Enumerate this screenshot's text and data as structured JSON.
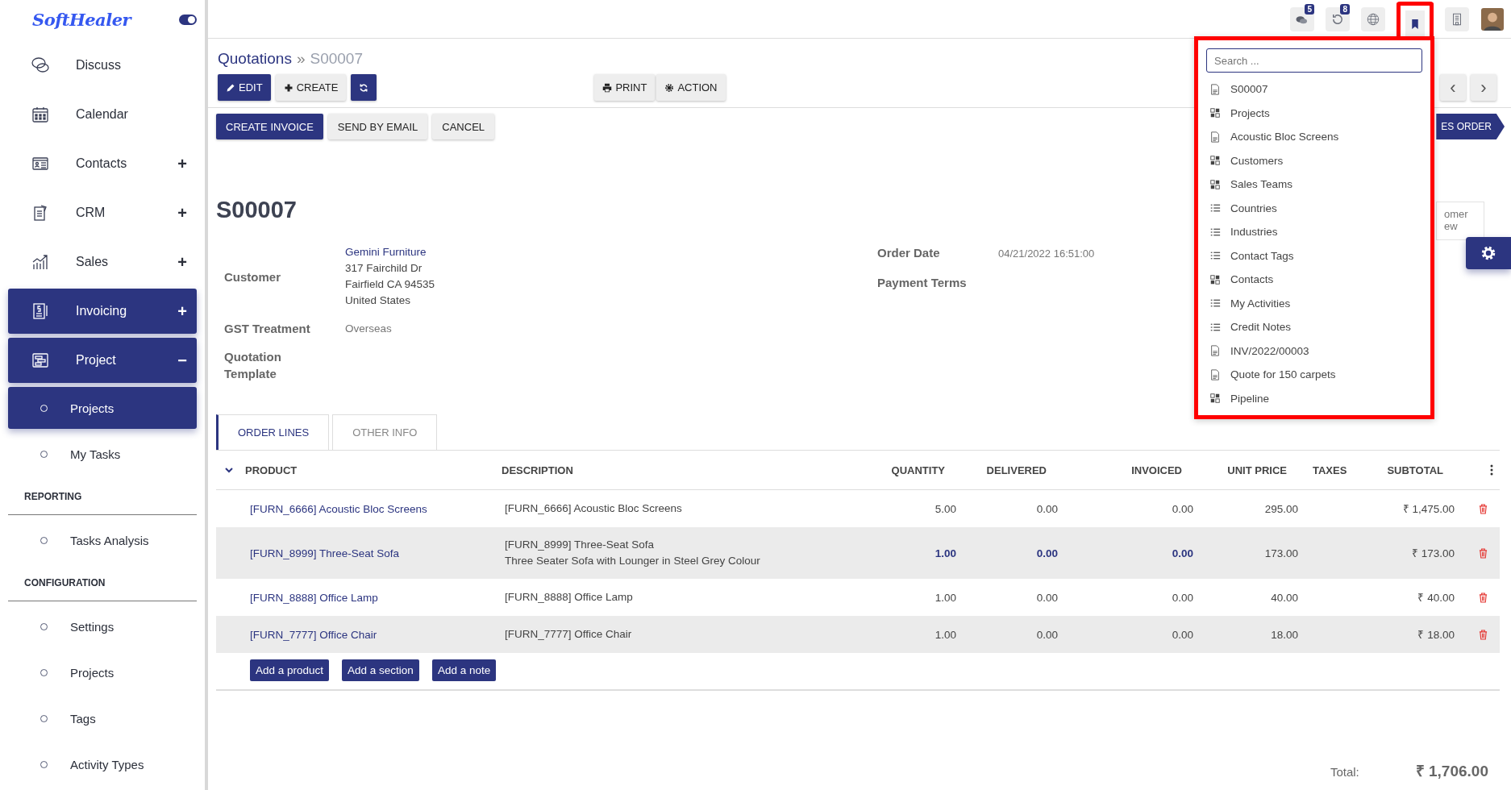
{
  "sidebar": {
    "logo": "SoftHealer",
    "theme_toggle": {
      "on": true
    },
    "items": [
      {
        "kind": "app",
        "label": "Discuss",
        "selected": false
      },
      {
        "kind": "app",
        "label": "Calendar",
        "selected": false
      },
      {
        "kind": "app",
        "label": "Contacts",
        "toggle": "+",
        "selected": false
      },
      {
        "kind": "app",
        "label": "CRM",
        "toggle": "+",
        "selected": false
      },
      {
        "kind": "app",
        "label": "Sales",
        "toggle": "+",
        "selected": false
      },
      {
        "kind": "app",
        "label": "Invoicing",
        "toggle": "+",
        "selected": true
      },
      {
        "kind": "app",
        "label": "Project",
        "toggle": "−",
        "selected": true,
        "children": [
          {
            "kind": "link",
            "label": "Projects",
            "selected": true
          },
          {
            "kind": "link",
            "label": "My Tasks",
            "selected": false
          },
          {
            "kind": "section",
            "label": "REPORTING"
          },
          {
            "kind": "link",
            "label": "Tasks Analysis",
            "selected": false
          },
          {
            "kind": "section",
            "label": "CONFIGURATION"
          },
          {
            "kind": "link",
            "label": "Settings",
            "selected": false
          },
          {
            "kind": "link",
            "label": "Projects",
            "selected": false
          },
          {
            "kind": "link",
            "label": "Tags",
            "selected": false
          },
          {
            "kind": "link",
            "label": "Activity Types",
            "selected": false
          }
        ]
      }
    ]
  },
  "topbar": {
    "icons": [
      {
        "kind": "chat",
        "badge": "5",
        "highlighted": false
      },
      {
        "kind": "clock",
        "badge": "8",
        "highlighted": false
      },
      {
        "kind": "globe",
        "highlighted": false
      },
      {
        "kind": "bookmark",
        "highlighted": true
      },
      {
        "kind": "building",
        "highlighted": false
      },
      {
        "kind": "avatar",
        "highlighted": false
      }
    ]
  },
  "breadcrumb": {
    "parent": "Quotations",
    "separator": "»",
    "current": "S00007"
  },
  "toolbar": {
    "buttons": [
      {
        "kind": "primary",
        "label": "EDIT"
      },
      {
        "kind": "secondary",
        "label": "CREATE"
      },
      {
        "kind": "primary"
      }
    ],
    "actions": [
      {
        "label": "PRINT"
      },
      {
        "label": "ACTION"
      }
    ],
    "pager": [
      "‹",
      "›"
    ]
  },
  "status_buttons": [
    {
      "kind": "primary",
      "label": "CREATE INVOICE"
    },
    {
      "kind": "secondary",
      "label": "SEND BY EMAIL"
    },
    {
      "kind": "secondary",
      "label": "CANCEL"
    }
  ],
  "status_stage": "ES ORDER",
  "smart_button": [
    "omer",
    "ew"
  ],
  "form": {
    "title": "S00007",
    "left": [
      {
        "label": "Customer",
        "link": "Gemini Furniture",
        "lines": [
          "317 Fairchild Dr",
          "Fairfield CA 94535",
          "United States"
        ]
      },
      {
        "label": "GST Treatment",
        "value": "Overseas"
      },
      {
        "label": "Quotation Template"
      }
    ],
    "right": [
      {
        "label": "Order Date",
        "value": "04/21/2022 16:51:00"
      },
      {
        "label": "Payment Terms"
      }
    ]
  },
  "tabs": [
    {
      "label": "ORDER LINES",
      "selected": true
    },
    {
      "label": "OTHER INFO",
      "selected": false
    }
  ],
  "table": {
    "columns": [
      "PRODUCT",
      "DESCRIPTION",
      "QUANTITY",
      "DELIVERED",
      "INVOICED",
      "UNIT PRICE",
      "TAXES",
      "SUBTOTAL"
    ],
    "rows": [
      {
        "product": "[FURN_6666] Acoustic Bloc Screens",
        "description": [
          "[FURN_6666] Acoustic Bloc Screens"
        ],
        "quantity": "5.00",
        "delivered": "0.00",
        "invoiced": "0.00",
        "unit_price": "295.00",
        "subtotal": "₹ 1,475.00",
        "highlighted": false
      },
      {
        "product": "[FURN_8999] Three-Seat Sofa",
        "description": [
          "[FURN_8999] Three-Seat Sofa",
          "Three Seater Sofa with Lounger in Steel Grey Colour"
        ],
        "quantity": "1.00",
        "delivered": "0.00",
        "invoiced": "0.00",
        "unit_price": "173.00",
        "subtotal": "₹ 173.00",
        "highlighted": true
      },
      {
        "product": "[FURN_8888] Office Lamp",
        "description": [
          "[FURN_8888] Office Lamp"
        ],
        "quantity": "1.00",
        "delivered": "0.00",
        "invoiced": "0.00",
        "unit_price": "40.00",
        "subtotal": "₹ 40.00",
        "highlighted": false
      },
      {
        "product": "[FURN_7777] Office Chair",
        "description": [
          "[FURN_7777] Office Chair"
        ],
        "quantity": "1.00",
        "delivered": "0.00",
        "invoiced": "0.00",
        "unit_price": "18.00",
        "subtotal": "₹ 18.00",
        "highlighted": false
      }
    ],
    "add_buttons": [
      "Add a product",
      "Add a section",
      "Add a note"
    ]
  },
  "total": {
    "label": "Total:",
    "value": "₹ 1,706.00"
  },
  "bookmark_menu": {
    "search": {
      "placeholder": "Search ..."
    },
    "items": [
      {
        "kind": "record",
        "label": "S00007"
      },
      {
        "kind": "kanban",
        "label": "Projects"
      },
      {
        "kind": "record",
        "label": "Acoustic Bloc Screens"
      },
      {
        "kind": "kanban",
        "label": "Customers"
      },
      {
        "kind": "kanban",
        "label": "Sales Teams"
      },
      {
        "kind": "list",
        "label": "Countries"
      },
      {
        "kind": "list",
        "label": "Industries"
      },
      {
        "kind": "list",
        "label": "Contact Tags"
      },
      {
        "kind": "kanban",
        "label": "Contacts"
      },
      {
        "kind": "list",
        "label": "My Activities"
      },
      {
        "kind": "list",
        "label": "Credit Notes"
      },
      {
        "kind": "record",
        "label": "INV/2022/00003"
      },
      {
        "kind": "record",
        "label": "Quote for 150 carpets"
      },
      {
        "kind": "kanban",
        "label": "Pipeline"
      }
    ]
  }
}
